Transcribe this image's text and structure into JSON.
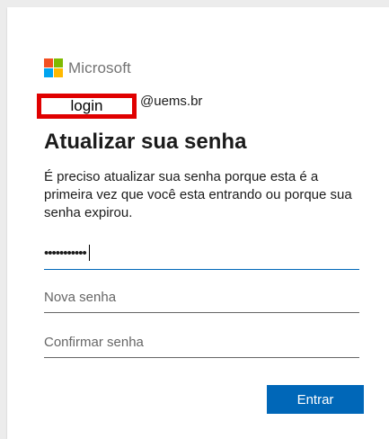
{
  "brand": {
    "name": "Microsoft",
    "colors": [
      "#f25022",
      "#7fba00",
      "#00a4ef",
      "#ffb900"
    ]
  },
  "identity": {
    "login_label": "login",
    "domain": "@uems.br"
  },
  "title": "Atualizar sua senha",
  "description": "É preciso atualizar sua senha porque esta é a primeira vez que você esta entrando ou porque sua senha expirou.",
  "fields": {
    "current_password_value": "•••••••••••",
    "new_password_placeholder": "Nova senha",
    "confirm_password_placeholder": "Confirmar senha"
  },
  "submit_label": "Entrar",
  "accent_color": "#0067b8"
}
